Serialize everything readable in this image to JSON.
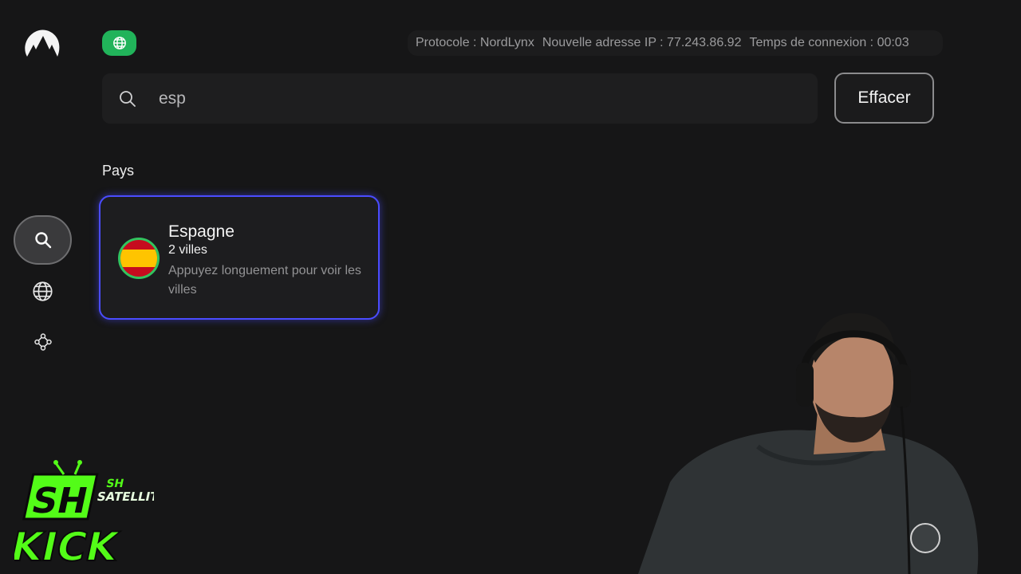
{
  "header": {
    "status_icon": "globe-icon",
    "protocol": "Protocole : NordLynx",
    "ip": "Nouvelle adresse IP : 77.243.86.92",
    "connection_time": "Temps de connexion : 00:03"
  },
  "search": {
    "value": "esp",
    "clear_label": "Effacer"
  },
  "results": {
    "section_title": "Pays",
    "countries": [
      {
        "name": "Espagne",
        "cities": "2 villes",
        "hint": "Appuyez longuement pour voir les villes",
        "flag_icon": "spain-flag-icon"
      }
    ]
  },
  "sidebar": {
    "items": [
      {
        "icon": "search-icon",
        "active": true
      },
      {
        "icon": "globe-icon",
        "active": false
      },
      {
        "icon": "specialty-servers-icon",
        "active": false
      }
    ]
  },
  "overlay": {
    "channel_logo_text": [
      "SH",
      "SH SATELLITE",
      "KICK"
    ]
  },
  "colors": {
    "background": "#161617",
    "accent_green": "#21b35a",
    "focus_blue": "#4a4cff",
    "kick_green": "#53fc18"
  }
}
